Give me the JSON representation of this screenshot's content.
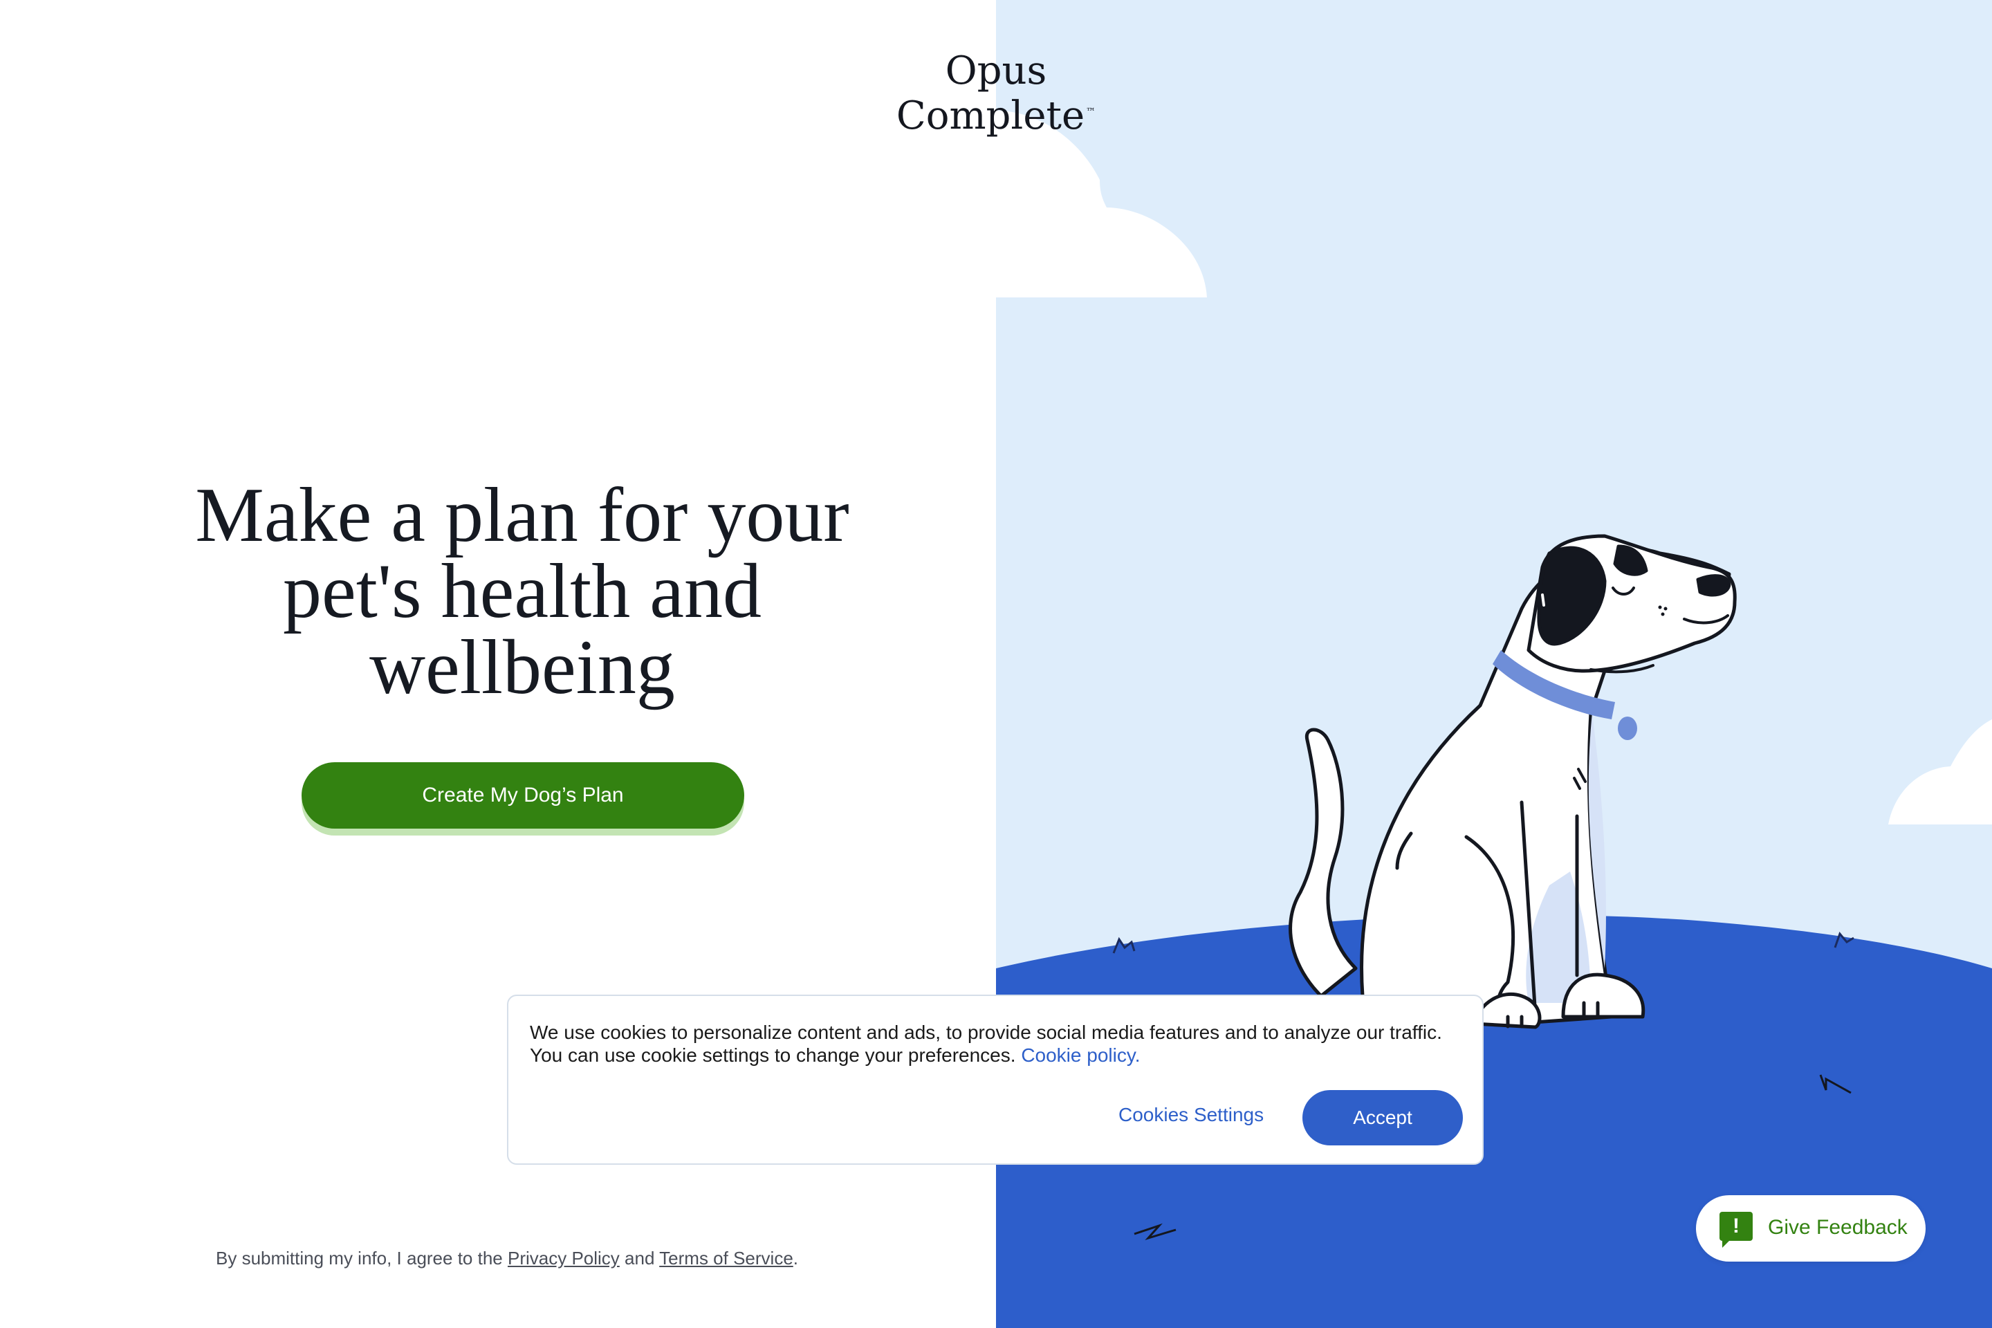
{
  "brand": {
    "name": "Opus Complete",
    "trademark": "™"
  },
  "hero": {
    "headline": "Make a plan for your pet's health and wellbeing",
    "cta_label": "Create My Dog’s Plan"
  },
  "legal": {
    "prefix": "By submitting my info, I agree to the ",
    "privacy_link": "Privacy Policy",
    "middle": " and ",
    "terms_link": "Terms of Service",
    "suffix": "."
  },
  "cookie_banner": {
    "message": "We use cookies to personalize content and ads, to provide social media features and to analyze our traffic. You can use cookie settings to change your preferences. ",
    "policy_link": "Cookie policy.",
    "settings_label": "Cookies Settings",
    "accept_label": "Accept"
  },
  "feedback": {
    "icon": "feedback-icon",
    "icon_glyph": "!",
    "label": "Give Feedback"
  },
  "colors": {
    "primary_green": "#338211",
    "brand_blue": "#2f5fc9",
    "sky": "#deedfb",
    "hill": "#2d5ecb",
    "text_dark": "#161a22"
  },
  "illustration": {
    "subject": "dog-illustration"
  }
}
